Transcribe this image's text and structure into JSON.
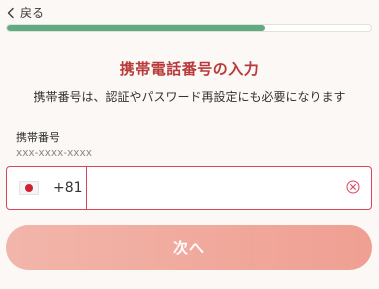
{
  "header": {
    "back_label": "戻る",
    "progress_fraction": 0.71
  },
  "main": {
    "title": "携帯電話番号の入力",
    "description": "携帯番号は、認証やパスワード再設定にも必要になります"
  },
  "phone_field": {
    "label": "携帯番号",
    "hint": "xxx-xxxx-xxxx",
    "country_flag": "japan-flag-icon",
    "dial_code": "+81",
    "value": "",
    "placeholder": ""
  },
  "actions": {
    "next_label": "次へ"
  },
  "colors": {
    "accent_title": "#b83a3a",
    "progress": "#5fab82",
    "input_border": "#d9455a",
    "button_start": "#f2b2a6",
    "button_end": "#ee9b8d"
  }
}
